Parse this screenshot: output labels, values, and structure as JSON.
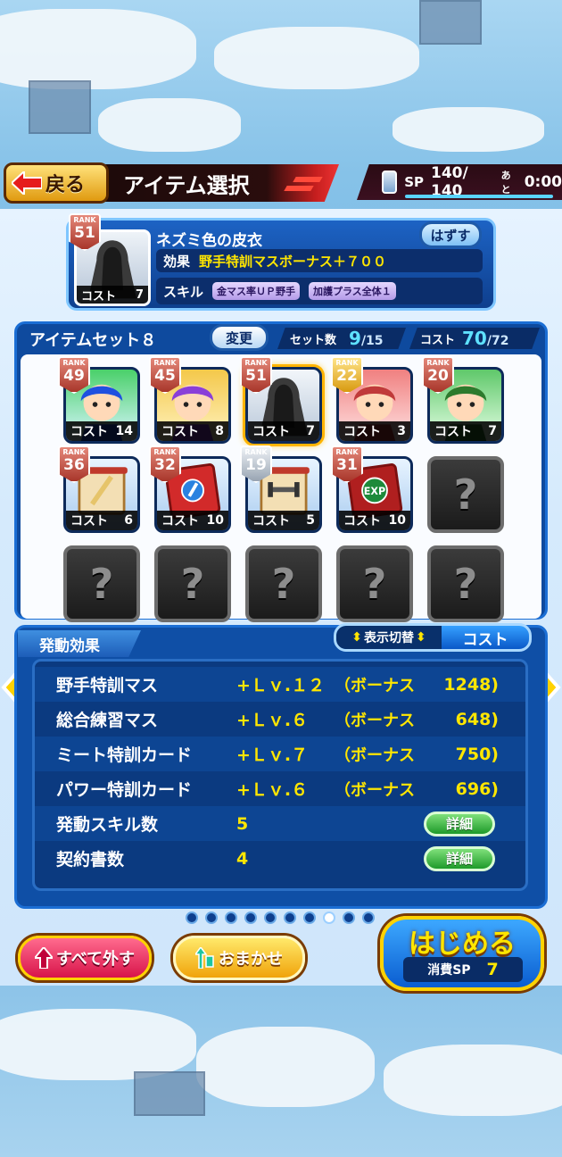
{
  "header": {
    "back_label": "戻る",
    "title": "アイテム選択",
    "sp_label": "SP",
    "sp_value": "140/ 140",
    "timer_label": "あと",
    "timer_value": "0:00"
  },
  "selected_item": {
    "rank_label": "RANK",
    "rank": "51",
    "cost_label": "コスト",
    "cost": "7",
    "name": "ネズミ色の皮衣",
    "remove_label": "はずす",
    "effect_label": "効果",
    "effect_value": "野手特訓マスボーナス＋７００",
    "skill_label": "スキル",
    "skills": [
      "金マス率ＵＰ野手",
      "加護プラス全体１"
    ]
  },
  "item_set": {
    "name": "アイテムセット８",
    "change_label": "変更",
    "set_count_label": "セット数",
    "set_count": "9",
    "set_count_max": "/15",
    "cost_label": "コスト",
    "cost_value": "70",
    "cost_max": "/72",
    "slots": [
      {
        "rank": "49",
        "cost": "14",
        "badge": "red",
        "art": "character-blue-hair"
      },
      {
        "rank": "45",
        "cost": "8",
        "badge": "red",
        "art": "character-purple-hair"
      },
      {
        "rank": "51",
        "cost": "7",
        "badge": "red",
        "art": "gray-cloak",
        "selected": true
      },
      {
        "rank": "22",
        "cost": "3",
        "badge": "gold",
        "art": "character-red-hair"
      },
      {
        "rank": "20",
        "cost": "7",
        "badge": "red",
        "art": "character-green-cap"
      },
      {
        "rank": "36",
        "cost": "6",
        "badge": "red",
        "art": "bat-scroll"
      },
      {
        "rank": "32",
        "cost": "10",
        "badge": "red",
        "art": "red-book"
      },
      {
        "rank": "19",
        "cost": "5",
        "badge": "silver",
        "art": "dumbbell-scroll"
      },
      {
        "rank": "31",
        "cost": "10",
        "badge": "red",
        "art": "exp-book"
      },
      {
        "empty": "?"
      },
      {
        "empty": "?"
      },
      {
        "empty": "?"
      },
      {
        "empty": "?"
      },
      {
        "empty": "?"
      },
      {
        "empty": "?"
      }
    ],
    "rank_label": "RANK",
    "slot_cost_label": "コスト"
  },
  "effects": {
    "tab_label": "発動効果",
    "toggle_label": "表示切替",
    "toggle_value": "コスト",
    "rows": [
      {
        "name": "野手特訓マス",
        "level": "+Ｌｖ.１２",
        "bonus_label": "（ボーナス",
        "bonus": "1248)"
      },
      {
        "name": "総合練習マス",
        "level": "+Ｌｖ.６",
        "bonus_label": "（ボーナス",
        "bonus": "648)"
      },
      {
        "name": "ミート特訓カード",
        "level": "+Ｌｖ.７",
        "bonus_label": "（ボーナス",
        "bonus": "750)"
      },
      {
        "name": "パワー特訓カード",
        "level": "+Ｌｖ.６",
        "bonus_label": "（ボーナス",
        "bonus": "696)"
      },
      {
        "name": "発動スキル数",
        "level": "5",
        "detail_label": "詳細"
      },
      {
        "name": "契約書数",
        "level": "4",
        "detail_label": "詳細"
      }
    ]
  },
  "pager": {
    "count": 10,
    "active_index": 7
  },
  "bottom": {
    "remove_all_label": "すべて外す",
    "auto_label": "おまかせ",
    "start_label": "はじめる",
    "start_cost_label": "消費SP",
    "start_cost_value": "7"
  },
  "colors": {
    "accent_yellow": "#ffe600",
    "panel_blue": "#0e4a9e",
    "title_red": "#c41e1e"
  }
}
